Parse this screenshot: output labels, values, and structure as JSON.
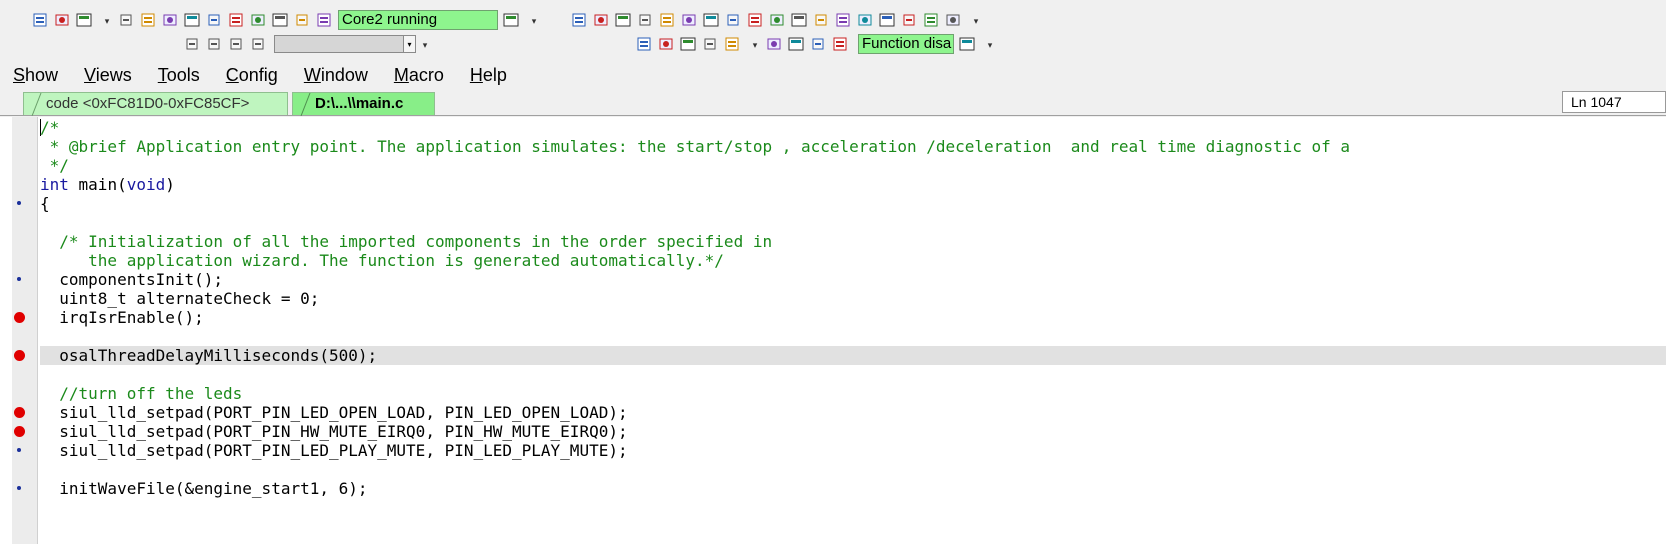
{
  "toolbar": {
    "row1_left_icons": [
      "cut-icon",
      "copy-icon",
      "paste-icon"
    ],
    "row1_debug_icons": [
      "step-cursor-icon",
      "run-icon",
      "step-source-icon",
      "step-into-icon",
      "step-over-icon",
      "step-out-icon",
      "step-return-icon",
      "break-icon",
      "reset-icon",
      "cpu-icon"
    ],
    "core_status": "Core2 running",
    "row1_window_icons": [
      "list-icon",
      "register-icon",
      "memory-icon",
      "stack-icon",
      "breakpoint-icon",
      "watch-icon",
      "var-icon",
      "trace-icon",
      "frame-icon",
      "symbol-icon",
      "peripheral-icon",
      "terminal-icon",
      "globe-icon",
      "chart-icon",
      "analyzer-icon",
      "window-icon",
      "table-icon",
      "group-icon"
    ],
    "row2_left_icons": [
      "page-icon",
      "page2-icon",
      "record-icon",
      "clip-icon"
    ],
    "combo_value": "",
    "row2_icons": [
      "trace-toggle-icon",
      "fork-icon",
      "network-icon",
      "grid-icon",
      "doc-icon",
      "debug-icon",
      "bug-icon",
      "flag-icon",
      "down-icon"
    ],
    "function_status": "Function disa",
    "function_icon": "function-icon",
    "more_glyph": "▾",
    "combo_glyph": "▾"
  },
  "menu": [
    {
      "accel": "S",
      "rest": "how"
    },
    {
      "accel": "V",
      "rest": "iews"
    },
    {
      "accel": "T",
      "rest": "ools"
    },
    {
      "accel": "C",
      "rest": "onfig"
    },
    {
      "accel": "W",
      "rest": "indow"
    },
    {
      "accel": "M",
      "rest": "acro"
    },
    {
      "accel": "H",
      "rest": "elp"
    }
  ],
  "tabs": [
    {
      "label": "code <0xFC81D0-0xFC85CF>",
      "active": false
    },
    {
      "label": "D:\\...\\\\main.c",
      "active": true
    }
  ],
  "line_indicator": "Ln 1047",
  "code": [
    {
      "text": "/*",
      "kind": "comment",
      "marker": ""
    },
    {
      "text": " * @brief Application entry point. The application simulates: the start/stop , acceleration /deceleration  and real time diagnostic of a",
      "kind": "comment",
      "marker": ""
    },
    {
      "text": " */",
      "kind": "comment",
      "marker": ""
    },
    {
      "text": "int main(void)",
      "kind": "main",
      "marker": ""
    },
    {
      "text": "{",
      "kind": "plain",
      "marker": "exec"
    },
    {
      "text": "",
      "kind": "plain",
      "marker": ""
    },
    {
      "text": "  /* Initialization of all the imported components in the order specified in",
      "kind": "comment",
      "marker": ""
    },
    {
      "text": "     the application wizard. The function is generated automatically.*/",
      "kind": "comment",
      "marker": ""
    },
    {
      "text": "  componentsInit();",
      "kind": "plain",
      "marker": "exec"
    },
    {
      "text": "  uint8_t alternateCheck = 0;",
      "kind": "plain",
      "marker": ""
    },
    {
      "text": "  irqIsrEnable();",
      "kind": "plain",
      "marker": "breakpoint"
    },
    {
      "text": "",
      "kind": "plain",
      "marker": ""
    },
    {
      "text": "  osalThreadDelayMilliseconds(500);",
      "kind": "plain",
      "marker": "breakpoint",
      "highlight": true
    },
    {
      "text": "",
      "kind": "plain",
      "marker": ""
    },
    {
      "text": "  //turn off the leds",
      "kind": "comment",
      "marker": ""
    },
    {
      "text": "  siul_lld_setpad(PORT_PIN_LED_OPEN_LOAD, PIN_LED_OPEN_LOAD);",
      "kind": "plain",
      "marker": "breakpoint"
    },
    {
      "text": "  siul_lld_setpad(PORT_PIN_HW_MUTE_EIRQ0, PIN_HW_MUTE_EIRQ0);",
      "kind": "plain",
      "marker": "breakpoint"
    },
    {
      "text": "  siul_lld_setpad(PORT_PIN_LED_PLAY_MUTE, PIN_LED_PLAY_MUTE);",
      "kind": "plain",
      "marker": "exec"
    },
    {
      "text": "",
      "kind": "plain",
      "marker": ""
    },
    {
      "text": "  initWaveFile(&engine_start1, 6);",
      "kind": "plain",
      "marker": "exec"
    }
  ],
  "colors": {
    "status_green": "#8ef58e",
    "tab_active": "#88ee88",
    "tab_inactive": "#bff5bf",
    "comment": "#1b8a1b",
    "keyword": "#1a1aa0",
    "breakpoint": "#e00000",
    "line_highlight": "#e1e1e1"
  }
}
